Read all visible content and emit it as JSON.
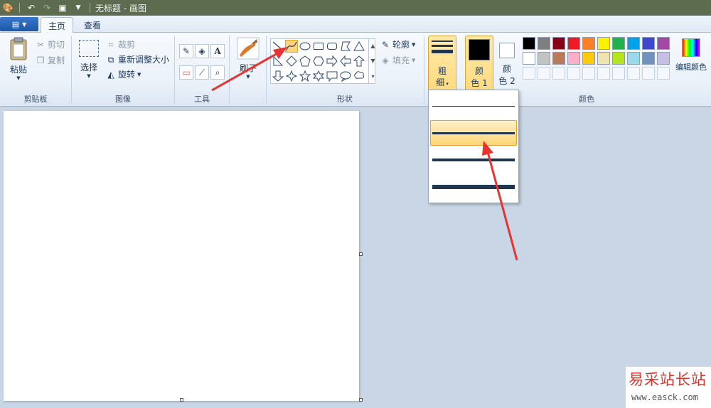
{
  "window": {
    "title": "无标题 - 画图"
  },
  "tabs": [
    {
      "label": "主页",
      "active": true
    },
    {
      "label": "查看",
      "active": false
    }
  ],
  "clipboard": {
    "paste": "粘贴",
    "cut": "剪切",
    "copy": "复制",
    "group": "剪贴板"
  },
  "image": {
    "select": "选择",
    "crop": "裁剪",
    "resize": "重新调整大小",
    "rotate": "旋转",
    "group": "图像"
  },
  "tools": {
    "group": "工具",
    "letter_a": "A"
  },
  "brushes": {
    "label": "刷子"
  },
  "shapes": {
    "outline": "轮廓",
    "fill": "填充",
    "group": "形状"
  },
  "size": {
    "label_line1": "粗",
    "label_line2": "细"
  },
  "colors": {
    "color1_line1": "颜",
    "color1_line2": "色 1",
    "color2_line1": "颜",
    "color2_line2": "色 2",
    "edit": "编辑颜色",
    "group": "颜色",
    "color1_value": "#000000",
    "color2_value": "#ffffff",
    "palette_row1": [
      "#000000",
      "#7f7f7f",
      "#880015",
      "#ed1c24",
      "#ff7f27",
      "#fff200",
      "#22b14c",
      "#00a2e8",
      "#3f48cc",
      "#a349a4"
    ],
    "palette_row2": [
      "#ffffff",
      "#c3c3c3",
      "#b97a57",
      "#ffaec9",
      "#ffc90e",
      "#efe4b0",
      "#b5e61d",
      "#99d9ea",
      "#7092be",
      "#c8bfe7"
    ]
  },
  "watermark": {
    "title": "易采站长站",
    "url": "www.easck.com"
  }
}
